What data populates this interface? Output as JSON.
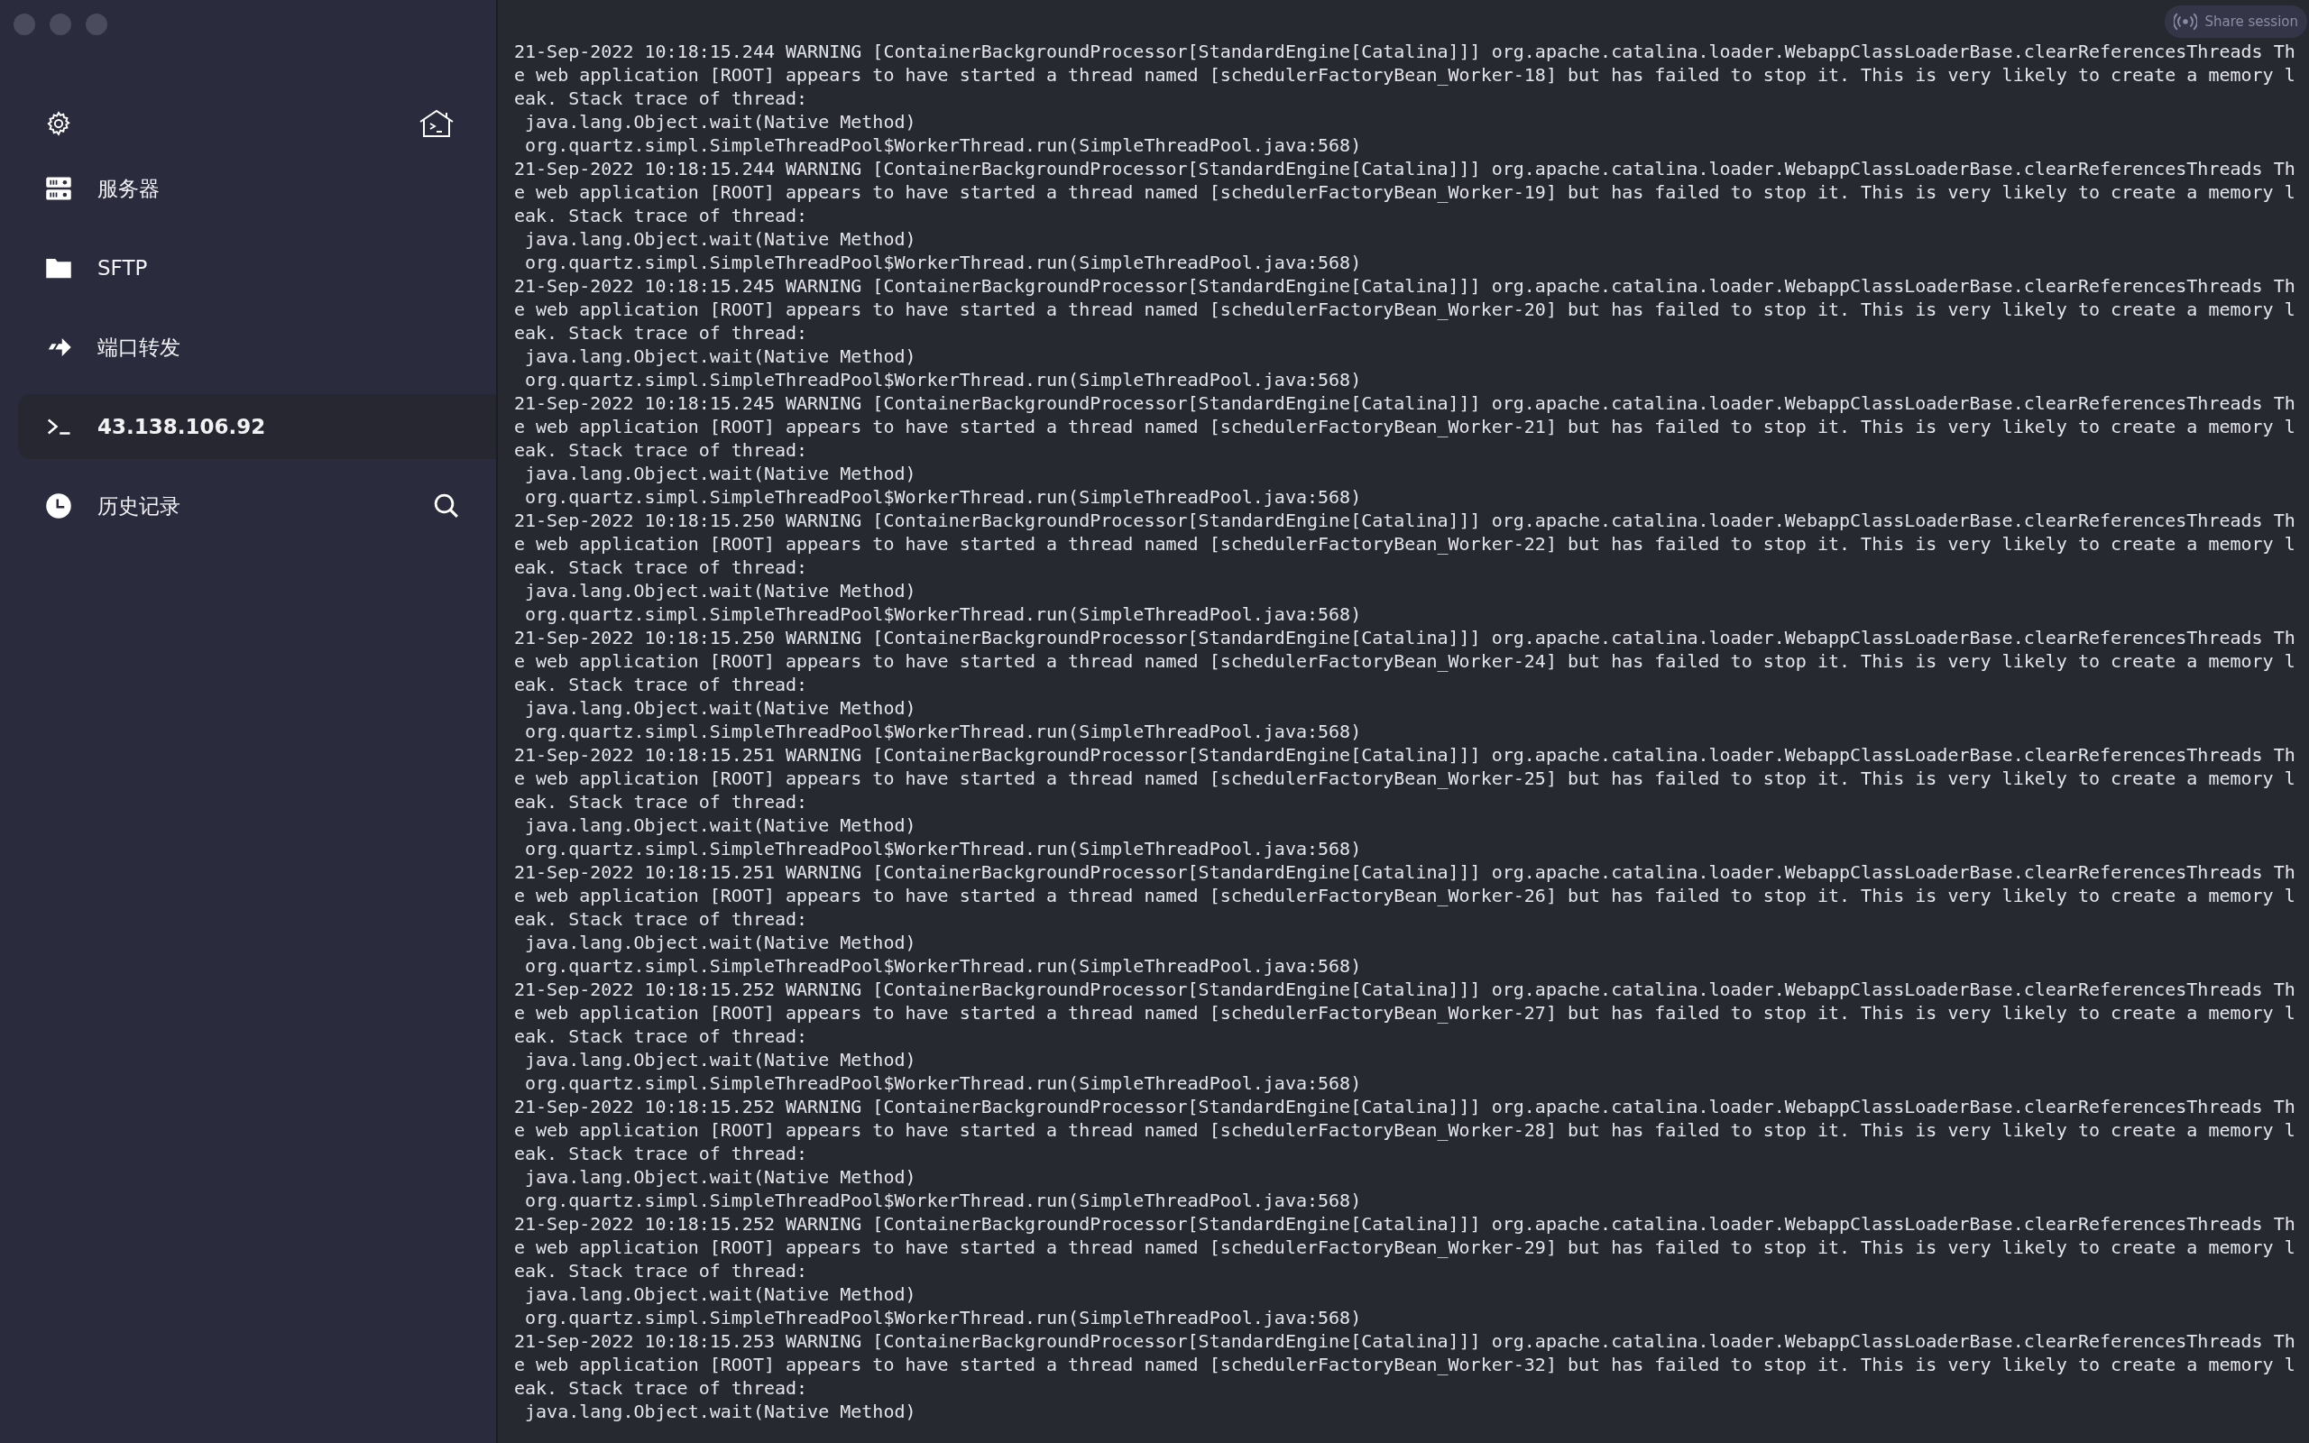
{
  "sidebar": {
    "items": [
      {
        "label": "服务器",
        "selected": false
      },
      {
        "label": "SFTP",
        "selected": false
      },
      {
        "label": "端口转发",
        "selected": false
      },
      {
        "label": "43.138.106.92",
        "selected": true
      },
      {
        "label": "历史记录",
        "selected": false
      }
    ]
  },
  "share_button": {
    "label": "Share session"
  },
  "terminal_lines": [
    "21-Sep-2022 10:18:15.244 WARNING [ContainerBackgroundProcessor[StandardEngine[Catalina]]] org.apache.catalina.loader.WebappClassLoaderBase.clearReferencesThreads Th",
    "e web application [ROOT] appears to have started a thread named [schedulerFactoryBean_Worker-18] but has failed to stop it. This is very likely to create a memory l",
    "eak. Stack trace of thread:",
    " java.lang.Object.wait(Native Method)",
    " org.quartz.simpl.SimpleThreadPool$WorkerThread.run(SimpleThreadPool.java:568)",
    "21-Sep-2022 10:18:15.244 WARNING [ContainerBackgroundProcessor[StandardEngine[Catalina]]] org.apache.catalina.loader.WebappClassLoaderBase.clearReferencesThreads Th",
    "e web application [ROOT] appears to have started a thread named [schedulerFactoryBean_Worker-19] but has failed to stop it. This is very likely to create a memory l",
    "eak. Stack trace of thread:",
    " java.lang.Object.wait(Native Method)",
    " org.quartz.simpl.SimpleThreadPool$WorkerThread.run(SimpleThreadPool.java:568)",
    "21-Sep-2022 10:18:15.245 WARNING [ContainerBackgroundProcessor[StandardEngine[Catalina]]] org.apache.catalina.loader.WebappClassLoaderBase.clearReferencesThreads Th",
    "e web application [ROOT] appears to have started a thread named [schedulerFactoryBean_Worker-20] but has failed to stop it. This is very likely to create a memory l",
    "eak. Stack trace of thread:",
    " java.lang.Object.wait(Native Method)",
    " org.quartz.simpl.SimpleThreadPool$WorkerThread.run(SimpleThreadPool.java:568)",
    "21-Sep-2022 10:18:15.245 WARNING [ContainerBackgroundProcessor[StandardEngine[Catalina]]] org.apache.catalina.loader.WebappClassLoaderBase.clearReferencesThreads Th",
    "e web application [ROOT] appears to have started a thread named [schedulerFactoryBean_Worker-21] but has failed to stop it. This is very likely to create a memory l",
    "eak. Stack trace of thread:",
    " java.lang.Object.wait(Native Method)",
    " org.quartz.simpl.SimpleThreadPool$WorkerThread.run(SimpleThreadPool.java:568)",
    "21-Sep-2022 10:18:15.250 WARNING [ContainerBackgroundProcessor[StandardEngine[Catalina]]] org.apache.catalina.loader.WebappClassLoaderBase.clearReferencesThreads Th",
    "e web application [ROOT] appears to have started a thread named [schedulerFactoryBean_Worker-22] but has failed to stop it. This is very likely to create a memory l",
    "eak. Stack trace of thread:",
    " java.lang.Object.wait(Native Method)",
    " org.quartz.simpl.SimpleThreadPool$WorkerThread.run(SimpleThreadPool.java:568)",
    "21-Sep-2022 10:18:15.250 WARNING [ContainerBackgroundProcessor[StandardEngine[Catalina]]] org.apache.catalina.loader.WebappClassLoaderBase.clearReferencesThreads Th",
    "e web application [ROOT] appears to have started a thread named [schedulerFactoryBean_Worker-24] but has failed to stop it. This is very likely to create a memory l",
    "eak. Stack trace of thread:",
    " java.lang.Object.wait(Native Method)",
    " org.quartz.simpl.SimpleThreadPool$WorkerThread.run(SimpleThreadPool.java:568)",
    "21-Sep-2022 10:18:15.251 WARNING [ContainerBackgroundProcessor[StandardEngine[Catalina]]] org.apache.catalina.loader.WebappClassLoaderBase.clearReferencesThreads Th",
    "e web application [ROOT] appears to have started a thread named [schedulerFactoryBean_Worker-25] but has failed to stop it. This is very likely to create a memory l",
    "eak. Stack trace of thread:",
    " java.lang.Object.wait(Native Method)",
    " org.quartz.simpl.SimpleThreadPool$WorkerThread.run(SimpleThreadPool.java:568)",
    "21-Sep-2022 10:18:15.251 WARNING [ContainerBackgroundProcessor[StandardEngine[Catalina]]] org.apache.catalina.loader.WebappClassLoaderBase.clearReferencesThreads Th",
    "e web application [ROOT] appears to have started a thread named [schedulerFactoryBean_Worker-26] but has failed to stop it. This is very likely to create a memory l",
    "eak. Stack trace of thread:",
    " java.lang.Object.wait(Native Method)",
    " org.quartz.simpl.SimpleThreadPool$WorkerThread.run(SimpleThreadPool.java:568)",
    "21-Sep-2022 10:18:15.252 WARNING [ContainerBackgroundProcessor[StandardEngine[Catalina]]] org.apache.catalina.loader.WebappClassLoaderBase.clearReferencesThreads Th",
    "e web application [ROOT] appears to have started a thread named [schedulerFactoryBean_Worker-27] but has failed to stop it. This is very likely to create a memory l",
    "eak. Stack trace of thread:",
    " java.lang.Object.wait(Native Method)",
    " org.quartz.simpl.SimpleThreadPool$WorkerThread.run(SimpleThreadPool.java:568)",
    "21-Sep-2022 10:18:15.252 WARNING [ContainerBackgroundProcessor[StandardEngine[Catalina]]] org.apache.catalina.loader.WebappClassLoaderBase.clearReferencesThreads Th",
    "e web application [ROOT] appears to have started a thread named [schedulerFactoryBean_Worker-28] but has failed to stop it. This is very likely to create a memory l",
    "eak. Stack trace of thread:",
    " java.lang.Object.wait(Native Method)",
    " org.quartz.simpl.SimpleThreadPool$WorkerThread.run(SimpleThreadPool.java:568)",
    "21-Sep-2022 10:18:15.252 WARNING [ContainerBackgroundProcessor[StandardEngine[Catalina]]] org.apache.catalina.loader.WebappClassLoaderBase.clearReferencesThreads Th",
    "e web application [ROOT] appears to have started a thread named [schedulerFactoryBean_Worker-29] but has failed to stop it. This is very likely to create a memory l",
    "eak. Stack trace of thread:",
    " java.lang.Object.wait(Native Method)",
    " org.quartz.simpl.SimpleThreadPool$WorkerThread.run(SimpleThreadPool.java:568)",
    "21-Sep-2022 10:18:15.253 WARNING [ContainerBackgroundProcessor[StandardEngine[Catalina]]] org.apache.catalina.loader.WebappClassLoaderBase.clearReferencesThreads Th",
    "e web application [ROOT] appears to have started a thread named [schedulerFactoryBean_Worker-32] but has failed to stop it. This is very likely to create a memory l",
    "eak. Stack trace of thread:",
    " java.lang.Object.wait(Native Method)"
  ]
}
